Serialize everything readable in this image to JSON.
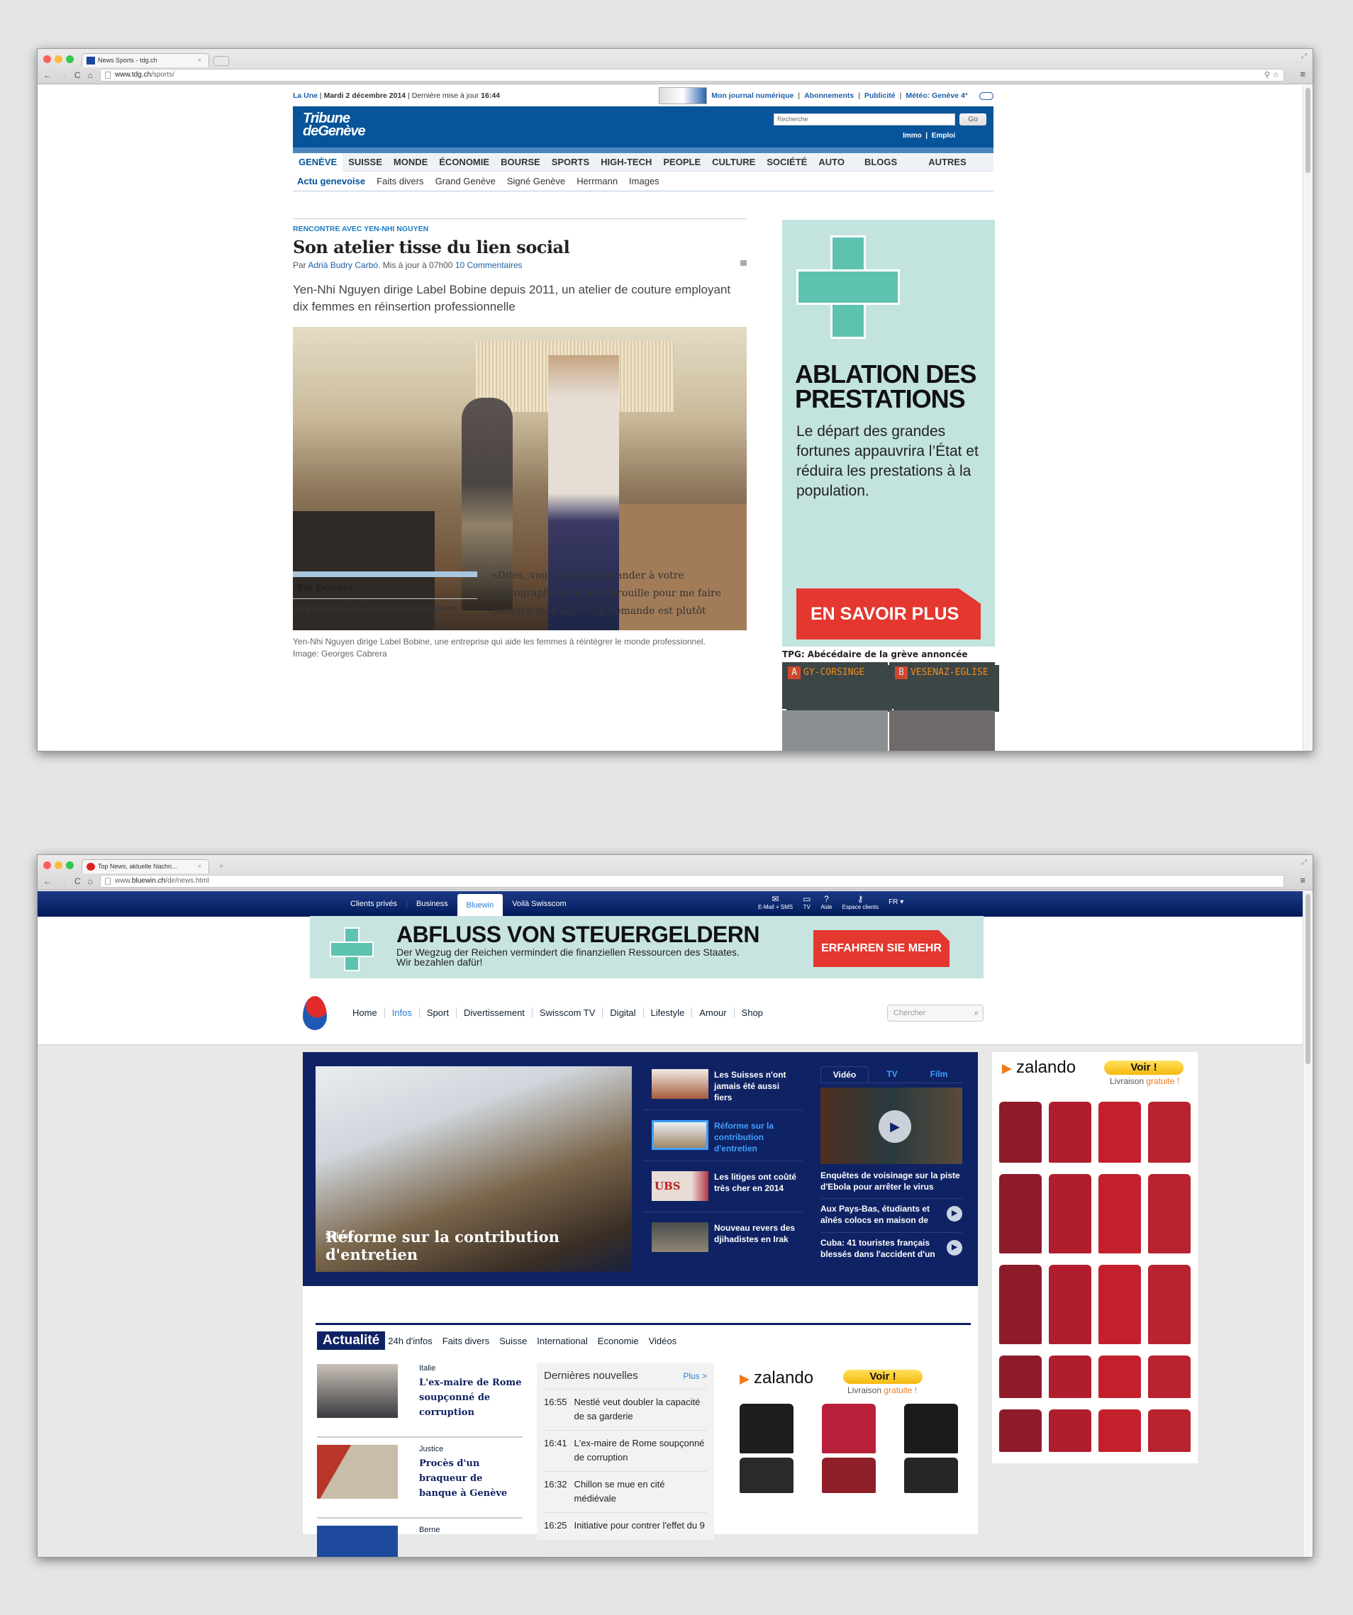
{
  "window1": {
    "tab_title": "News Sports - tdg.ch",
    "url_domain": "www.tdg.ch",
    "url_path": "/sports/",
    "topbar": {
      "la_une": "La Une",
      "date": "Mardi 2 décembre 2014",
      "updated_label": "Dernière mise à jour",
      "updated_time": "16:44",
      "links": [
        "Mon journal numérique",
        "Abonnements",
        "Publicité",
        "Météo: Genève 4°"
      ]
    },
    "logo_line1": "Tribune",
    "logo_line2": "deGenève",
    "search_placeholder": "Recherche",
    "search_button": "Go",
    "mast_links": [
      "Immo",
      "Emploi"
    ],
    "nav_primary": [
      "GENÈVE",
      "SUISSE",
      "MONDE",
      "ÉCONOMIE",
      "BOURSE",
      "SPORTS",
      "HIGH-TECH",
      "PEOPLE",
      "CULTURE",
      "SOCIÉTÉ",
      "AUTO",
      "BLOGS",
      "AUTRES"
    ],
    "nav_secondary": [
      "Actu genevoise",
      "Faits divers",
      "Grand Genève",
      "Signé Genève",
      "Herrmann",
      "Images"
    ],
    "article": {
      "kicker": "RENCONTRE AVEC YEN-NHI NGUYEN",
      "title": "Son atelier tisse du lien social",
      "by_prefix": "Par",
      "author": "Adrià Budry Carbó",
      "updated": ". Mis à jour à 07h00",
      "comments": "10 Commentaires",
      "lead": "Yen-Nhi Nguyen dirige Label Bobine depuis 2011, un atelier de couture employant dix femmes en réinsertion professionnelle",
      "caption": "Yen-Nhi Nguyen dirige Label Bobine, une entreprise qui aide les femmes à réintégrer le monde professionnel.",
      "credit": "Image: Georges Cabrera",
      "body": "«Dites, vous pouvez demander à votre photographe qu’il se débrouille pour me faire paraître mon âge?» La demande est plutôt"
    },
    "bio": {
      "title": "Bio Express",
      "year": "1976",
      "text": "Naissance à Lausanne et déménagement"
    },
    "ad": {
      "headline": "ABLATION DES PRESTATIONS",
      "text": "Le départ des grandes fortunes appauvrira l’État et réduira les prestations à la population.",
      "button": "EN SAVOIR PLUS",
      "bg_color": "#c3e3de",
      "button_color": "#e4372f"
    },
    "tpg": {
      "title": "TPG: Abécédaire de la grève annoncée",
      "sign_a_letter": "A",
      "sign_a": "GY-CORSINGE",
      "sign_b_letter": "B",
      "sign_b": "VESENAZ-EGLISE"
    }
  },
  "window2": {
    "tab_title": "Top News, aktuelle Nachri...",
    "url_prefix": "www.",
    "url_domain": "bluewin.ch",
    "url_path": "/de/news.html",
    "topnav": [
      "Clients privés",
      "Business",
      "Bluewin",
      "Voilà Swisscom"
    ],
    "utility": [
      "E-Mail + SMS",
      "TV",
      "Aide",
      "Espace clients"
    ],
    "lang": "FR",
    "ad": {
      "headline": "ABFLUSS VON STEUERGELDERN",
      "text1": "Der Wegzug der Reichen vermindert die finanziellen Ressourcen des Staates.",
      "text2": "Wir bezahlen dafür!",
      "button": "ERFAHREN SIE MEHR"
    },
    "mainnav": [
      "Home",
      "Infos",
      "Sport",
      "Divertissement",
      "Swisscom TV",
      "Digital",
      "Lifestyle",
      "Amour",
      "Shop"
    ],
    "search_placeholder": "Chercher",
    "hero": {
      "kicker": "Suisse",
      "title": "Réforme sur la contribution d'entretien",
      "list": [
        "Les Suisses n'ont jamais été aussi fiers",
        "Réforme sur la contribution d'entretien",
        "Les litiges ont coûté très cher en 2014",
        "Nouveau revers des djihadistes en Irak"
      ],
      "video_tabs": [
        "Vidéo",
        "TV",
        "Film"
      ],
      "video_title": "Enquêtes de voisinage sur la piste d'Ebola pour arrêter le virus",
      "video_items": [
        "Aux Pays-Bas, étudiants et aînés colocs en maison de",
        "Cuba: 41 touristes français blessés dans l'accident d'un"
      ]
    },
    "actualite": {
      "tabs": [
        "Actualité",
        "24h d'infos",
        "Faits divers",
        "Suisse",
        "International",
        "Economie",
        "Vidéos"
      ],
      "news": [
        {
          "kicker": "Italie",
          "title": "L'ex-maire de Rome soupçonné de corruption"
        },
        {
          "kicker": "Justice",
          "title": "Procès d'un braqueur de banque à Genève"
        },
        {
          "kicker": "Berne",
          "title": ""
        }
      ],
      "latest_title": "Dernières nouvelles",
      "latest_more": "Plus >",
      "latest": [
        {
          "time": "16:55",
          "text": "Nestlé veut doubler la capacité de sa garderie"
        },
        {
          "time": "16:41",
          "text": "L'ex-maire de Rome soupçonné de corruption"
        },
        {
          "time": "16:32",
          "text": "Chillon se mue en cité médiévale"
        },
        {
          "time": "16:25",
          "text": "Initiative pour contrer l'effet du 9"
        }
      ]
    },
    "zalando": {
      "brand": "zalando",
      "button": "Voir !",
      "delivery": "Livraison",
      "free": "gratuite !"
    }
  }
}
